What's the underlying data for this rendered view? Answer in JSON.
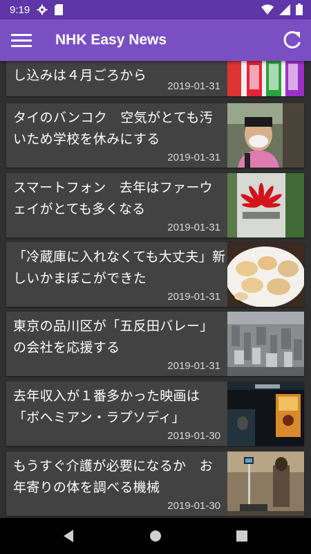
{
  "status_bar": {
    "time": "9:19",
    "icons": [
      "gear-icon",
      "sd-card-icon",
      "wifi-icon",
      "signal-icon",
      "battery-icon"
    ]
  },
  "app_bar": {
    "title": "NHK Easy News",
    "menu_icon": "menu-icon",
    "refresh_icon": "refresh-icon",
    "color": "#7b4fc4"
  },
  "articles": [
    {
      "headline": "し込みは４月ごろから",
      "date": "2019-01-31",
      "thumb": "chart-thumbnail"
    },
    {
      "headline": "タイのバンコク　空気がとても汚いため学校を休みにする",
      "date": "2019-01-31",
      "thumb": "boy-with-mask-thumbnail"
    },
    {
      "headline": "スマートフォン　去年はファーウェイがとても多くなる",
      "date": "2019-01-31",
      "thumb": "huawei-logo-thumbnail"
    },
    {
      "headline": "「冷蔵庫に入れなくても大丈夫」新しいかまぼこができた",
      "date": "2019-01-31",
      "thumb": "kamaboko-thumbnail"
    },
    {
      "headline": "東京の品川区が「五反田バレー」の会社を応援する",
      "date": "2019-01-31",
      "thumb": "city-aerial-thumbnail"
    },
    {
      "headline": "去年収入が１番多かった映画は「ボヘミアン・ラプソディ」",
      "date": "2019-01-30",
      "thumb": "movie-screen-thumbnail"
    },
    {
      "headline": "もうすぐ介護が必要になるか　お年寄りの体を調べる機械",
      "date": "2019-01-30",
      "thumb": "machine-thumbnail"
    }
  ],
  "nav_bar": {
    "icons": [
      "back-icon",
      "home-icon",
      "recents-icon"
    ]
  }
}
